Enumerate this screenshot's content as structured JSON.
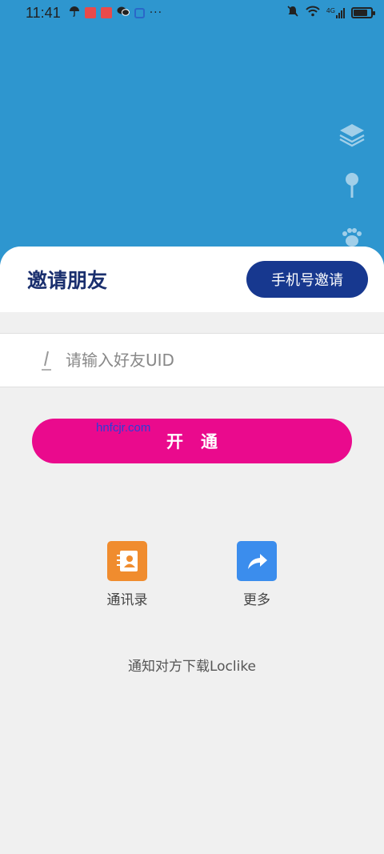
{
  "status_bar": {
    "time": "11:41",
    "network": "4G"
  },
  "map_tools": {
    "icons": [
      "layers-icon",
      "pin-icon",
      "footprint-icon"
    ]
  },
  "invite": {
    "title": "邀请朋友",
    "phone_invite_label": "手机号邀请",
    "uid_placeholder": "请输入好友UID",
    "uid_value": "",
    "activate_label": "开通",
    "watermark": "hnfcjr.com"
  },
  "share": {
    "items": [
      {
        "label": "通讯录",
        "icon": "contacts-icon"
      },
      {
        "label": "更多",
        "icon": "share-arrow-icon"
      }
    ],
    "notify_text": "通知对方下载Loclike"
  },
  "colors": {
    "map_bg": "#2e96cf",
    "primary_navy": "#17388f",
    "activate_pink": "#ea0a8d",
    "contacts_orange": "#f08c2e",
    "more_blue": "#3b8ded"
  }
}
